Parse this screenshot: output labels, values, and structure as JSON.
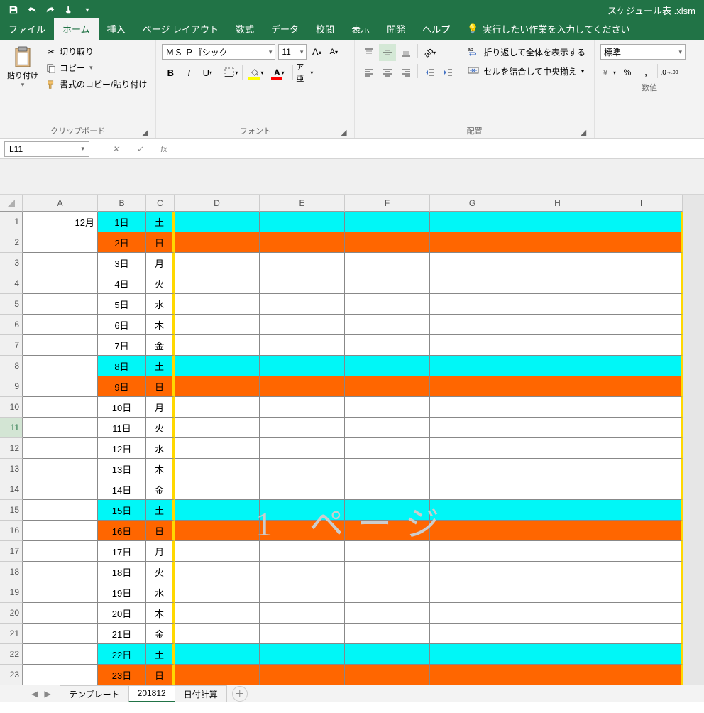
{
  "window": {
    "title": "スケジュール表 .xlsm"
  },
  "tabs": [
    "ファイル",
    "ホーム",
    "挿入",
    "ページ レイアウト",
    "数式",
    "データ",
    "校閲",
    "表示",
    "開発",
    "ヘルプ"
  ],
  "active_tab": "ホーム",
  "tellme": "実行したい作業を入力してください",
  "ribbon": {
    "clipboard": {
      "paste": "貼り付け",
      "cut": "切り取り",
      "copy": "コピー",
      "format_painter": "書式のコピー/貼り付け",
      "label": "クリップボード"
    },
    "font": {
      "name": "ＭＳ Ｐゴシック",
      "size": "11",
      "label": "フォント"
    },
    "alignment": {
      "wrap": "折り返して全体を表示する",
      "merge": "セルを結合して中央揃え",
      "label": "配置"
    },
    "number": {
      "format": "標準",
      "label": "数値"
    }
  },
  "namebox": "L11",
  "columns": [
    "A",
    "B",
    "C",
    "D",
    "E",
    "F",
    "G",
    "H",
    "I"
  ],
  "month_label": "12月",
  "watermark": "1 ページ",
  "rows": [
    {
      "n": 1,
      "day": "1日",
      "wd": "土",
      "cls": "sat"
    },
    {
      "n": 2,
      "day": "2日",
      "wd": "日",
      "cls": "sun"
    },
    {
      "n": 3,
      "day": "3日",
      "wd": "月",
      "cls": ""
    },
    {
      "n": 4,
      "day": "4日",
      "wd": "火",
      "cls": ""
    },
    {
      "n": 5,
      "day": "5日",
      "wd": "水",
      "cls": ""
    },
    {
      "n": 6,
      "day": "6日",
      "wd": "木",
      "cls": ""
    },
    {
      "n": 7,
      "day": "7日",
      "wd": "金",
      "cls": ""
    },
    {
      "n": 8,
      "day": "8日",
      "wd": "土",
      "cls": "sat"
    },
    {
      "n": 9,
      "day": "9日",
      "wd": "日",
      "cls": "sun"
    },
    {
      "n": 10,
      "day": "10日",
      "wd": "月",
      "cls": ""
    },
    {
      "n": 11,
      "day": "11日",
      "wd": "火",
      "cls": ""
    },
    {
      "n": 12,
      "day": "12日",
      "wd": "水",
      "cls": ""
    },
    {
      "n": 13,
      "day": "13日",
      "wd": "木",
      "cls": ""
    },
    {
      "n": 14,
      "day": "14日",
      "wd": "金",
      "cls": ""
    },
    {
      "n": 15,
      "day": "15日",
      "wd": "土",
      "cls": "sat"
    },
    {
      "n": 16,
      "day": "16日",
      "wd": "日",
      "cls": "sun"
    },
    {
      "n": 17,
      "day": "17日",
      "wd": "月",
      "cls": ""
    },
    {
      "n": 18,
      "day": "18日",
      "wd": "火",
      "cls": ""
    },
    {
      "n": 19,
      "day": "19日",
      "wd": "水",
      "cls": ""
    },
    {
      "n": 20,
      "day": "20日",
      "wd": "木",
      "cls": ""
    },
    {
      "n": 21,
      "day": "21日",
      "wd": "金",
      "cls": ""
    },
    {
      "n": 22,
      "day": "22日",
      "wd": "土",
      "cls": "sat"
    },
    {
      "n": 23,
      "day": "23日",
      "wd": "日",
      "cls": "sun"
    }
  ],
  "sheet_tabs": [
    "テンプレート",
    "201812",
    "日付計算"
  ],
  "active_sheet": "201812"
}
